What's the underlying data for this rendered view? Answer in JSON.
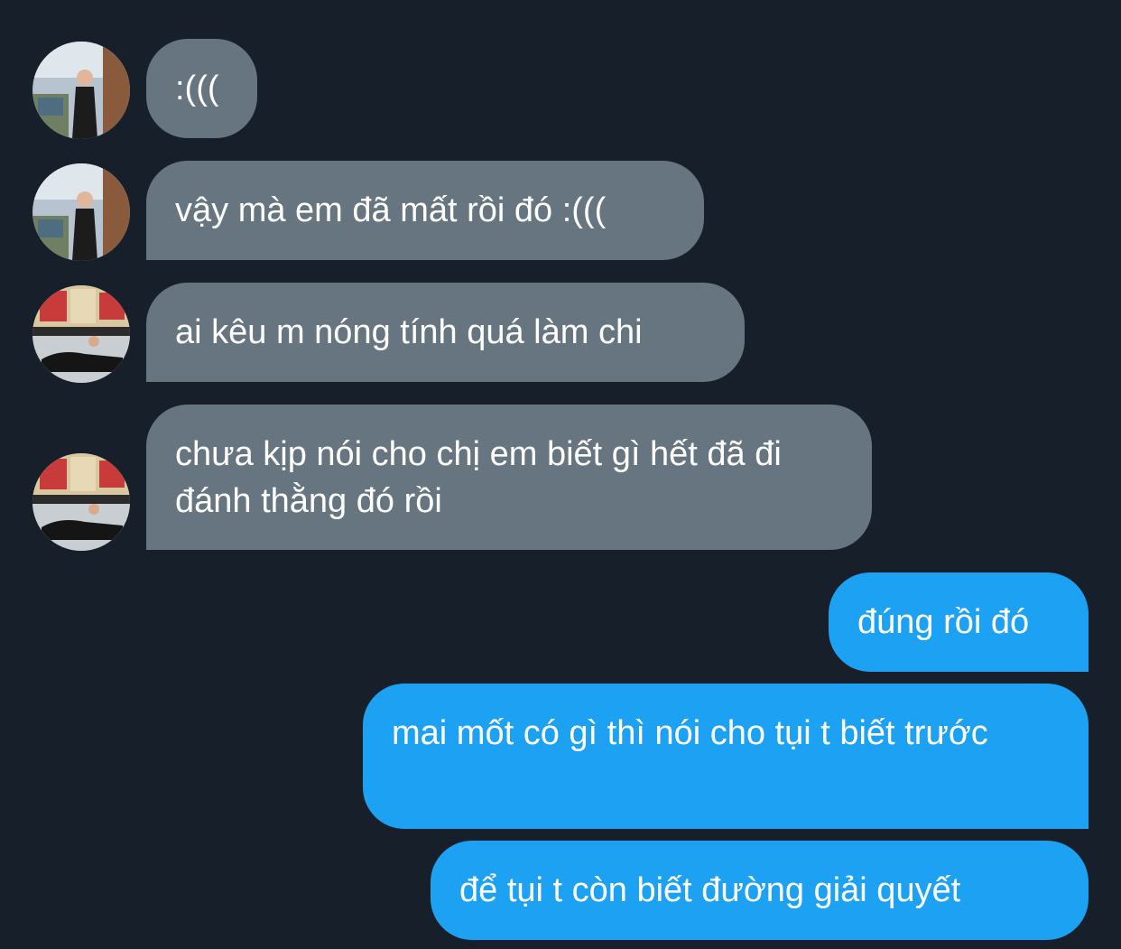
{
  "conversation": {
    "messages": [
      {
        "sender": "contact-a",
        "direction": "incoming",
        "text": ":((("
      },
      {
        "sender": "contact-a",
        "direction": "incoming",
        "text": "vậy mà em đã mất rồi đó :((("
      },
      {
        "sender": "contact-b",
        "direction": "incoming",
        "text": "ai kêu m nóng tính quá làm chi"
      },
      {
        "sender": "contact-b",
        "direction": "incoming",
        "text": "chưa kịp nói cho chị em biết gì hết đã đi đánh thằng đó rồi"
      },
      {
        "sender": "me",
        "direction": "outgoing",
        "text": "đúng rồi đó"
      },
      {
        "sender": "me",
        "direction": "outgoing",
        "text": "mai mốt có gì thì nói cho tụi t biết trước"
      },
      {
        "sender": "me",
        "direction": "outgoing",
        "text": "để tụi t còn biết đường giải quyết"
      }
    ]
  },
  "colors": {
    "background": "#17202a",
    "incoming_bubble": "#66757f",
    "outgoing_bubble": "#1da1f2",
    "text": "#ffffff"
  }
}
